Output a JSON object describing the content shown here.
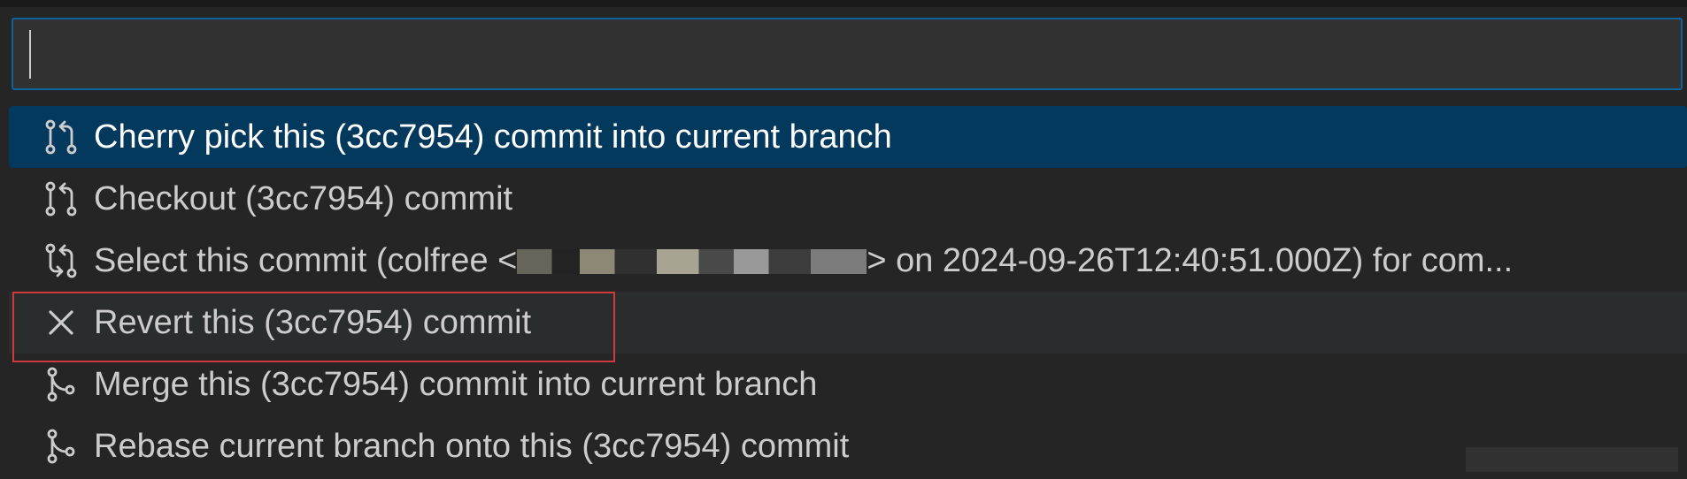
{
  "search": {
    "value": "",
    "placeholder": ""
  },
  "items": [
    {
      "label": "Cherry pick this (3cc7954) commit into current branch",
      "icon": "git-pull-request-icon",
      "state": "selected"
    },
    {
      "label": "Checkout (3cc7954) commit",
      "icon": "git-pull-request-icon",
      "state": "normal"
    },
    {
      "label_prefix": "Select this commit (colfree <",
      "label_suffix": "> on 2024-09-26T12:40:51.000Z) for com...",
      "icon": "git-compare-icon",
      "state": "normal"
    },
    {
      "label": "Revert this (3cc7954) commit",
      "icon": "close-icon",
      "state": "hover"
    },
    {
      "label": "Merge this (3cc7954) commit into current branch",
      "icon": "git-merge-icon",
      "state": "normal"
    },
    {
      "label": "Rebase current branch onto this (3cc7954) commit",
      "icon": "git-merge-icon",
      "state": "normal"
    }
  ],
  "colors": {
    "background": "#252526",
    "input_border": "#0e639c",
    "selected_row": "#04395e",
    "hover_row": "#2a2d2e",
    "highlight_box": "#d0393e",
    "text": "#cccccc"
  }
}
